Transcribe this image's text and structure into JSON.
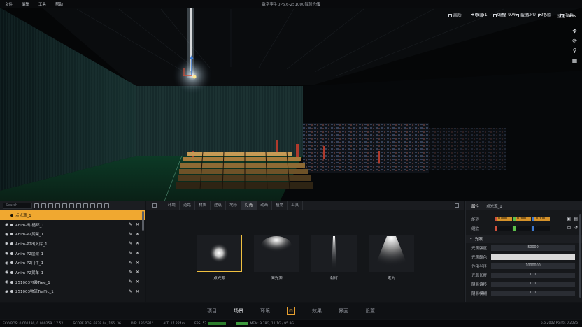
{
  "menu": [
    "文件",
    "编辑",
    "工具",
    "帮助"
  ],
  "window_title": "数字孪生UP6.6-251000智慧仓储",
  "stats": {
    "fps_label": "FPS",
    "fps_value": "51",
    "gpu_label": "GPU",
    "gpu_value": "97%",
    "cpu_label": "CPU",
    "cpu_value": "12%",
    "net_label": "延迟",
    "net_value": "0ms"
  },
  "view_buttons": [
    "画质",
    "速度",
    "视图",
    "截图",
    "日照",
    "视角"
  ],
  "outliner": {
    "search_placeholder": "Search",
    "items": [
      "点光源_1",
      "Anim-出-循环_1",
      "Anim-P2货架_1",
      "Anim-P2出入库_1",
      "Anim-P2层架_1",
      "Anim-P2门牛_1",
      "Anim-P2货车_1",
      "251003包装Tree_1",
      "251003物流Traffic_1"
    ]
  },
  "asset_tabs": [
    "环境",
    "道路",
    "材质",
    "建筑",
    "地形",
    "灯光",
    "动画",
    "植物",
    "工具"
  ],
  "asset_active_tab": 5,
  "light_assets": [
    "点光源",
    "面光源",
    "射灯",
    "定向"
  ],
  "properties": {
    "tab_title": "属性",
    "object_name": "点光源_1",
    "rotation_label": "旋转",
    "rotation_values": [
      "0.000",
      "0.000",
      "0.000"
    ],
    "scale_label": "缩放",
    "scale_values": [
      "1",
      "1",
      "1"
    ],
    "section": "光照",
    "fields": [
      {
        "label": "光照强度",
        "value": "50000"
      },
      {
        "label": "光照颜色",
        "value": ""
      },
      {
        "label": "作用半径",
        "value": "1000000"
      },
      {
        "label": "光源长度",
        "value": "0.0"
      },
      {
        "label": "阴影偏移",
        "value": "0.0"
      },
      {
        "label": "阴影模糊",
        "value": "0.0"
      }
    ]
  },
  "bottom_nav": [
    "项目",
    "场景",
    "环境",
    "",
    "效果",
    "界面",
    "设置"
  ],
  "bottom_nav_active": 1,
  "status_bar": {
    "eco": "ECO POS: 0.001490, 0.000259, 17.52",
    "scope": "SCOPE POS: 6878.04, 165, 36",
    "dir": "DIR: 186.581°",
    "alt": "ALT: 17.224m",
    "fps": "FPS: 52",
    "mem": "MEM: 9.78G, 11.1G / 95.8G",
    "right": "6.6.2002   Points 0 2026"
  },
  "colors": {
    "accent": "#f0a830",
    "selection_row": "#f0a830",
    "axis_x": "#d0503c",
    "axis_y": "#5cbf4a",
    "axis_z": "#3c78d0"
  }
}
